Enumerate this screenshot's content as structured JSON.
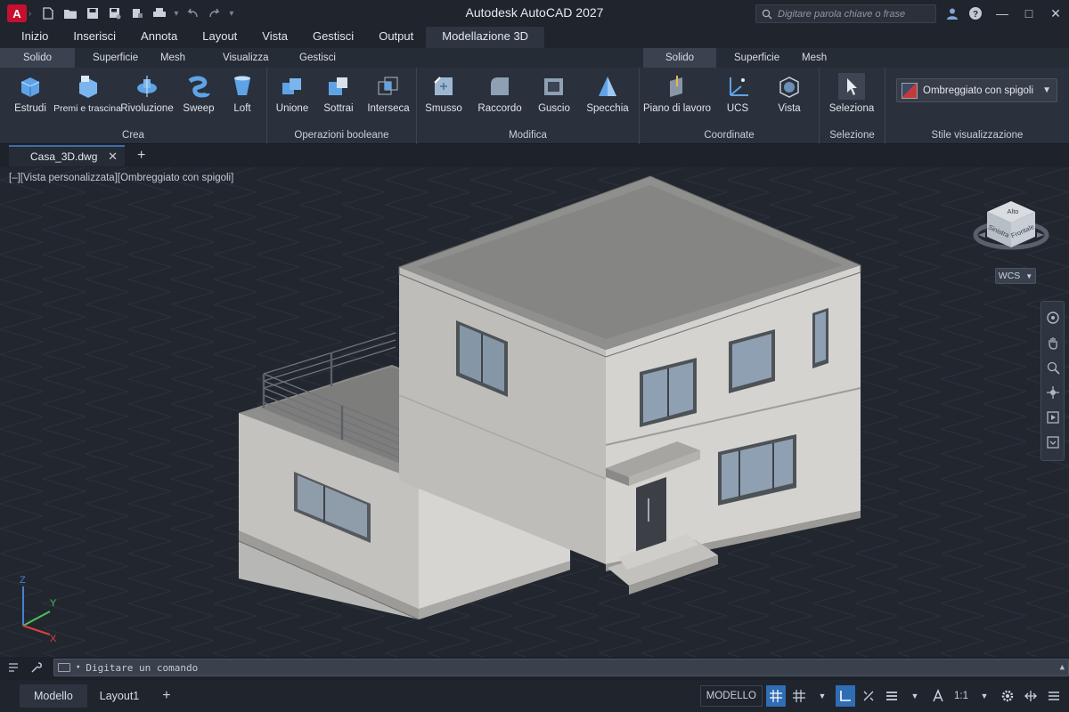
{
  "app": {
    "title": "Autodesk AutoCAD 2027",
    "logo_letter": "A",
    "search_placeholder": "Digitare parola chiave o frase"
  },
  "menu_tabs": [
    "Inizio",
    "Inserisci",
    "Annota",
    "Layout",
    "Vista",
    "Gestisci",
    "Output",
    "Modellazione 3D"
  ],
  "ribbon": {
    "left_subtabs": [
      "Solido",
      "Superficie",
      "Mesh",
      "Visualizza",
      "Gestisci"
    ],
    "right_subtabs": [
      "Solido",
      "Superficie",
      "Mesh"
    ],
    "panels": {
      "crea": {
        "title": "Crea",
        "buttons": [
          "Estrudi",
          "Premi e trascina",
          "Rivoluzione",
          "Sweep",
          "Loft"
        ]
      },
      "booleane": {
        "title": "Operazioni booleane",
        "buttons": [
          "Unione",
          "Sottrai",
          "Interseca"
        ]
      },
      "modifica": {
        "title": "Modifica",
        "buttons": [
          "Smusso",
          "Raccordo",
          "Guscio",
          "Specchia"
        ]
      },
      "coordinate": {
        "title": "Coordinate",
        "buttons": [
          "Piano di lavoro",
          "UCS",
          "Vista"
        ]
      },
      "selezione": {
        "title": "Selezione",
        "buttons": [
          "Seleziona"
        ]
      },
      "stile": {
        "title": "Stile visualizzazione",
        "value": "Ombreggiato con spigoli"
      }
    }
  },
  "document": {
    "tab_name": "Casa_3D.dwg"
  },
  "viewport": {
    "label": "[–][Vista personalizzata][Ombreggiato con spigoli]",
    "viewcube": {
      "top": "Alto",
      "left": "Sinistra",
      "front": "Frontale"
    },
    "wcs_label": "WCS",
    "ucs_axes": {
      "x": "X",
      "y": "Y",
      "z": "Z"
    }
  },
  "command_line": {
    "placeholder": "Digitare un comando"
  },
  "status_bar": {
    "layout_tabs": [
      "Modello",
      "Layout1"
    ],
    "model_label": "MODELLO",
    "scale": "1:1"
  },
  "colors": {
    "accent": "#2f6db5",
    "brand": "#c8102e"
  }
}
